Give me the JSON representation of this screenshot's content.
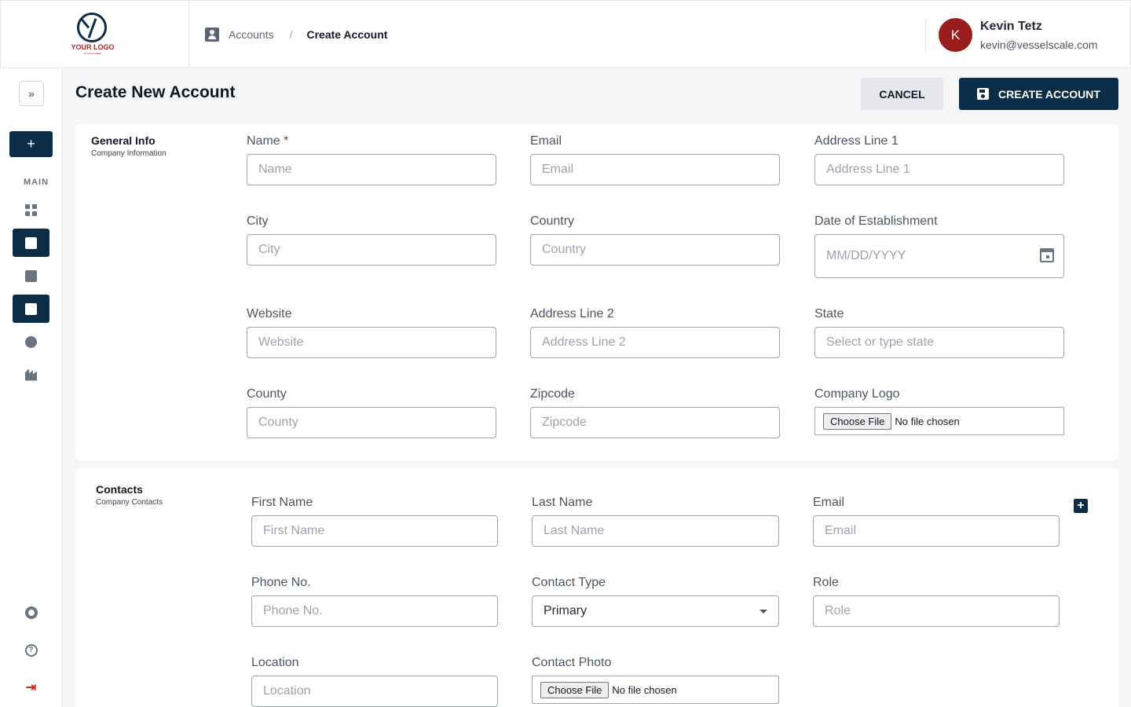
{
  "brand": {
    "logo_text": "YOUR LOGO",
    "logo_sub": "SLOGAN HERE"
  },
  "breadcrumb": {
    "parent": "Accounts",
    "separator": "/",
    "current": "Create Account"
  },
  "user": {
    "initial": "K",
    "name": "Kevin Tetz",
    "email": "kevin@vesselscale.com",
    "avatar_color": "#9a1c1c"
  },
  "sidebar": {
    "expand_icon": "»",
    "add_label": "+",
    "section_label": "MAIN",
    "items": [
      {
        "icon": "dashboard-icon",
        "active": false
      },
      {
        "icon": "contact-card-icon",
        "active": true
      },
      {
        "icon": "chart-icon",
        "active": false
      },
      {
        "icon": "reading-icon",
        "active": true
      },
      {
        "icon": "globe-icon",
        "active": false
      },
      {
        "icon": "factory-icon",
        "active": false
      }
    ],
    "bottom": [
      {
        "icon": "gear-icon"
      },
      {
        "icon": "help-icon",
        "glyph": "?"
      },
      {
        "icon": "logout-icon",
        "glyph": "⇥"
      }
    ]
  },
  "page": {
    "title": "Create New Account",
    "cancel_label": "CANCEL",
    "create_label": "CREATE ACCOUNT",
    "accent_color": "#0c2d48"
  },
  "general": {
    "title": "General Info",
    "subtitle": "Company Information",
    "fields": {
      "name": {
        "label": "Name *",
        "placeholder": "Name"
      },
      "email": {
        "label": "Email",
        "placeholder": "Email"
      },
      "address1": {
        "label": "Address Line 1",
        "placeholder": "Address Line 1"
      },
      "city": {
        "label": "City",
        "placeholder": "City"
      },
      "country": {
        "label": "Country",
        "placeholder": "Country"
      },
      "established": {
        "label": "Date of Establishment",
        "placeholder": "MM/DD/YYYY"
      },
      "website": {
        "label": "Website",
        "placeholder": "Website"
      },
      "address2": {
        "label": "Address Line 2",
        "placeholder": "Address Line 2"
      },
      "state": {
        "label": "State",
        "placeholder": "Select or type state"
      },
      "county": {
        "label": "County",
        "placeholder": "County"
      },
      "zipcode": {
        "label": "Zipcode",
        "placeholder": "Zipcode"
      },
      "logo": {
        "label": "Company Logo",
        "button": "Choose File",
        "status": "No file chosen"
      }
    }
  },
  "contacts": {
    "title": "Contacts",
    "subtitle": "Company Contacts",
    "add_icon": "+",
    "fields": {
      "first_name": {
        "label": "First Name",
        "placeholder": "First Name"
      },
      "last_name": {
        "label": "Last Name",
        "placeholder": "Last Name"
      },
      "email": {
        "label": "Email",
        "placeholder": "Email"
      },
      "phone": {
        "label": "Phone No.",
        "placeholder": "Phone No."
      },
      "contact_type": {
        "label": "Contact Type",
        "value": "Primary"
      },
      "role": {
        "label": "Role",
        "placeholder": "Role"
      },
      "location": {
        "label": "Location",
        "placeholder": "Location"
      },
      "photo": {
        "label": "Contact Photo",
        "button": "Choose File",
        "status": "No file chosen"
      }
    }
  }
}
